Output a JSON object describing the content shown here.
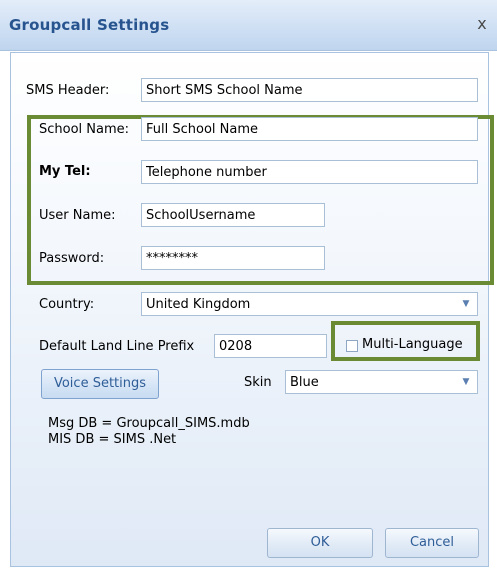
{
  "window": {
    "title": "Groupcall Settings",
    "close_glyph": "x"
  },
  "form": {
    "sms_header": {
      "label": "SMS Header:",
      "value": "Short SMS School Name"
    },
    "school_name": {
      "label": "School Name:",
      "value": "Full School Name"
    },
    "my_tel": {
      "label": "My Tel:",
      "value": "Telephone number"
    },
    "user_name": {
      "label": "User Name:",
      "value": "SchoolUsername"
    },
    "password": {
      "label": "Password:",
      "value": "********"
    },
    "country": {
      "label": "Country:",
      "value": "United Kingdom"
    },
    "prefix": {
      "label": "Default Land Line Prefix",
      "value": "0208"
    },
    "multi_language": {
      "label": "Multi-Language",
      "checked": false
    },
    "voice_settings_label": "Voice Settings",
    "skin": {
      "label": "Skin",
      "value": "Blue"
    },
    "db_info": {
      "msg_db": "Msg DB = Groupcall_SIMS.mdb",
      "mis_db": "MIS DB = SIMS .Net"
    }
  },
  "buttons": {
    "ok": "OK",
    "cancel": "Cancel"
  },
  "colors": {
    "title": "#27548f",
    "highlight": "#6b8a34",
    "button_text": "#2e5d97"
  },
  "icons": {
    "close": "close-icon",
    "dropdown": "chevron-down-icon"
  }
}
